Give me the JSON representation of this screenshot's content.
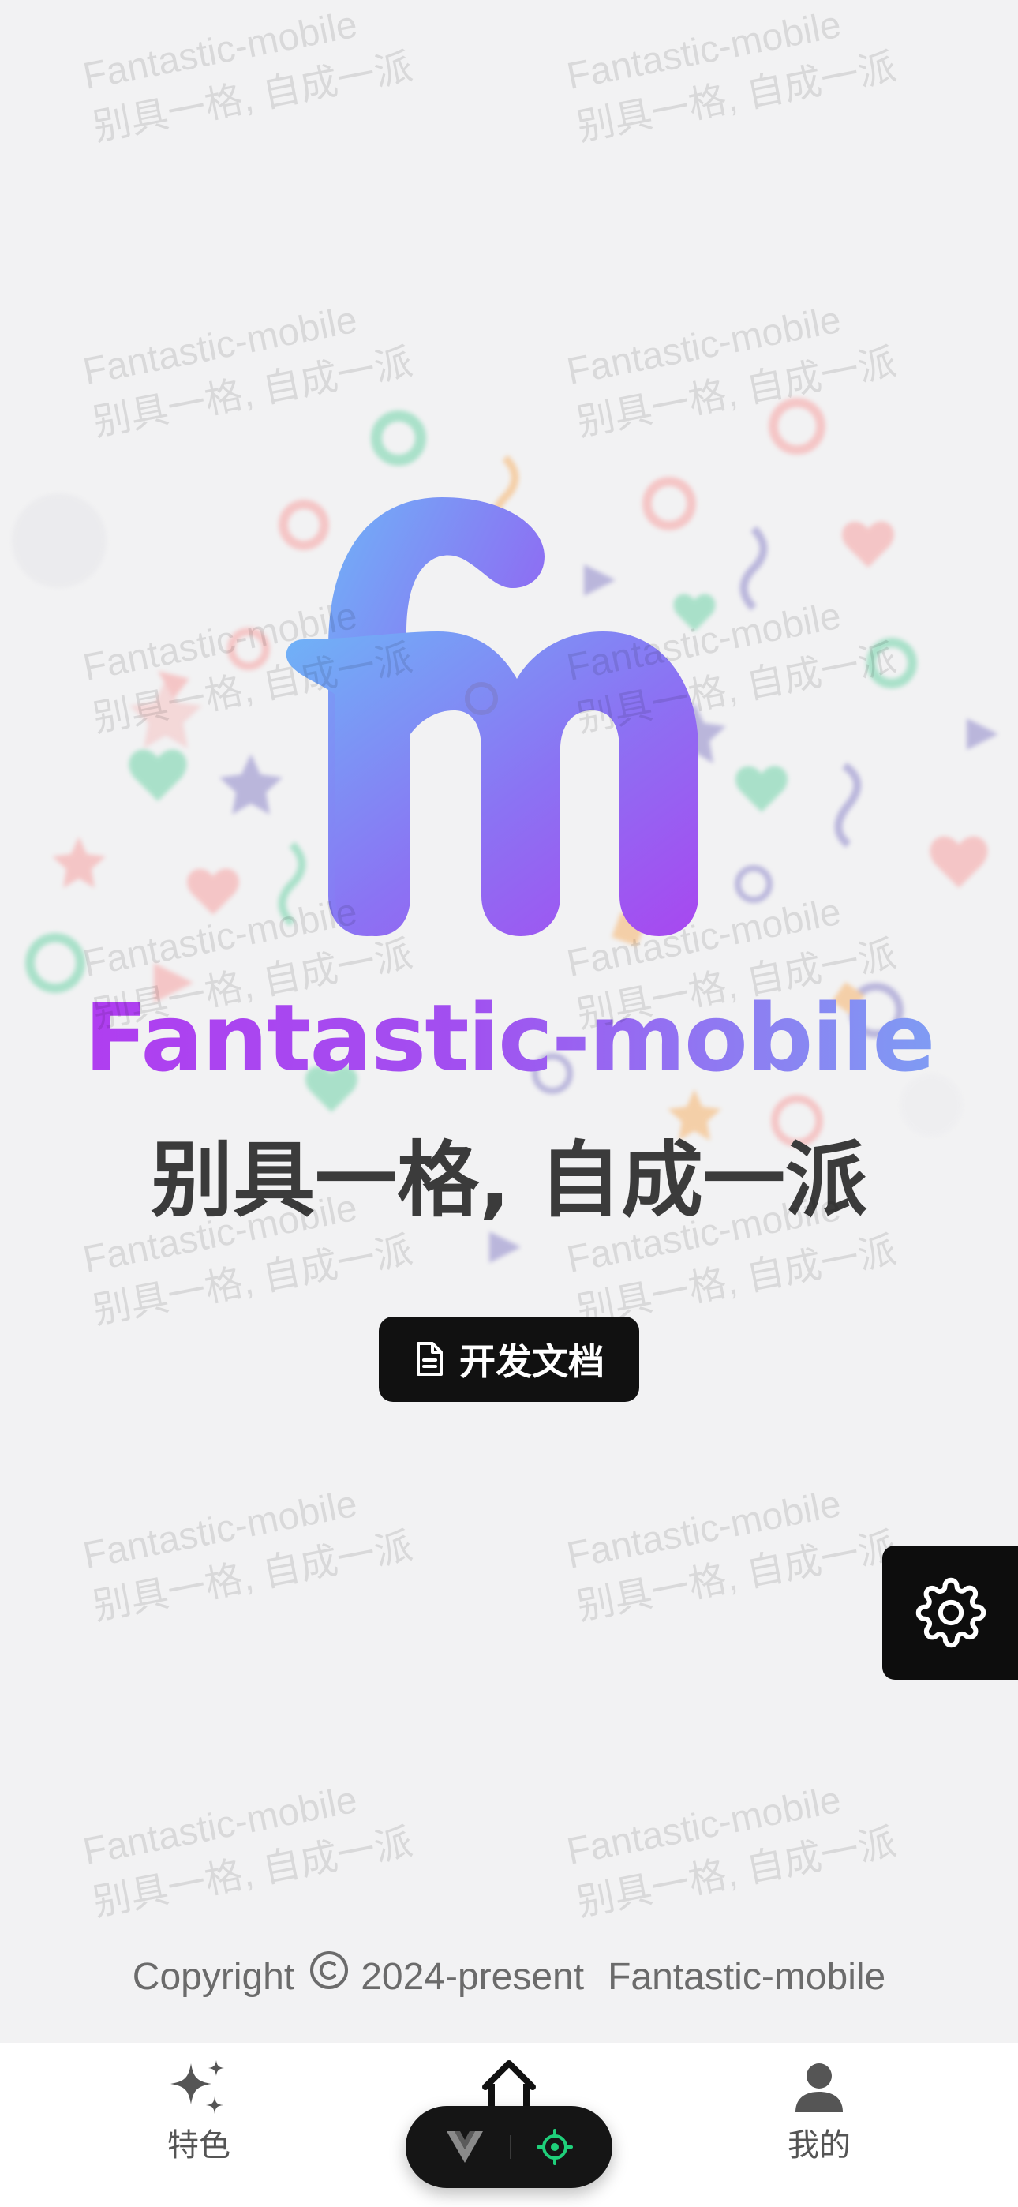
{
  "app": {
    "title": "Fantastic-mobile",
    "slogan": "别具一格, 自成一派"
  },
  "watermark": {
    "line1": "Fantastic-mobile",
    "line2": "别具一格, 自成一派"
  },
  "actions": {
    "docs_label": "开发文档",
    "docs_icon": "document-icon",
    "settings_icon": "gear-icon"
  },
  "footer": {
    "copyright_prefix": "Copyright",
    "copyright_icon": "copyright-icon",
    "years": "2024-present",
    "brand": "Fantastic-mobile"
  },
  "tabbar": {
    "items": [
      {
        "label": "特色",
        "icon": "sparkles-icon"
      },
      {
        "label": "",
        "icon": "home-icon"
      },
      {
        "label": "我的",
        "icon": "user-icon"
      }
    ]
  },
  "devtools": {
    "icons": [
      "vue-logo-icon",
      "crosshair-icon"
    ]
  },
  "colors": {
    "title_gradient_start": "#b33af0",
    "title_gradient_end": "#79a9f4",
    "logo_gradient_start": "#6fb3f7",
    "logo_gradient_end": "#a847f0",
    "button_bg": "#111111",
    "page_bg": "#f2f2f3",
    "devtools_accent": "#1fcf7a"
  }
}
